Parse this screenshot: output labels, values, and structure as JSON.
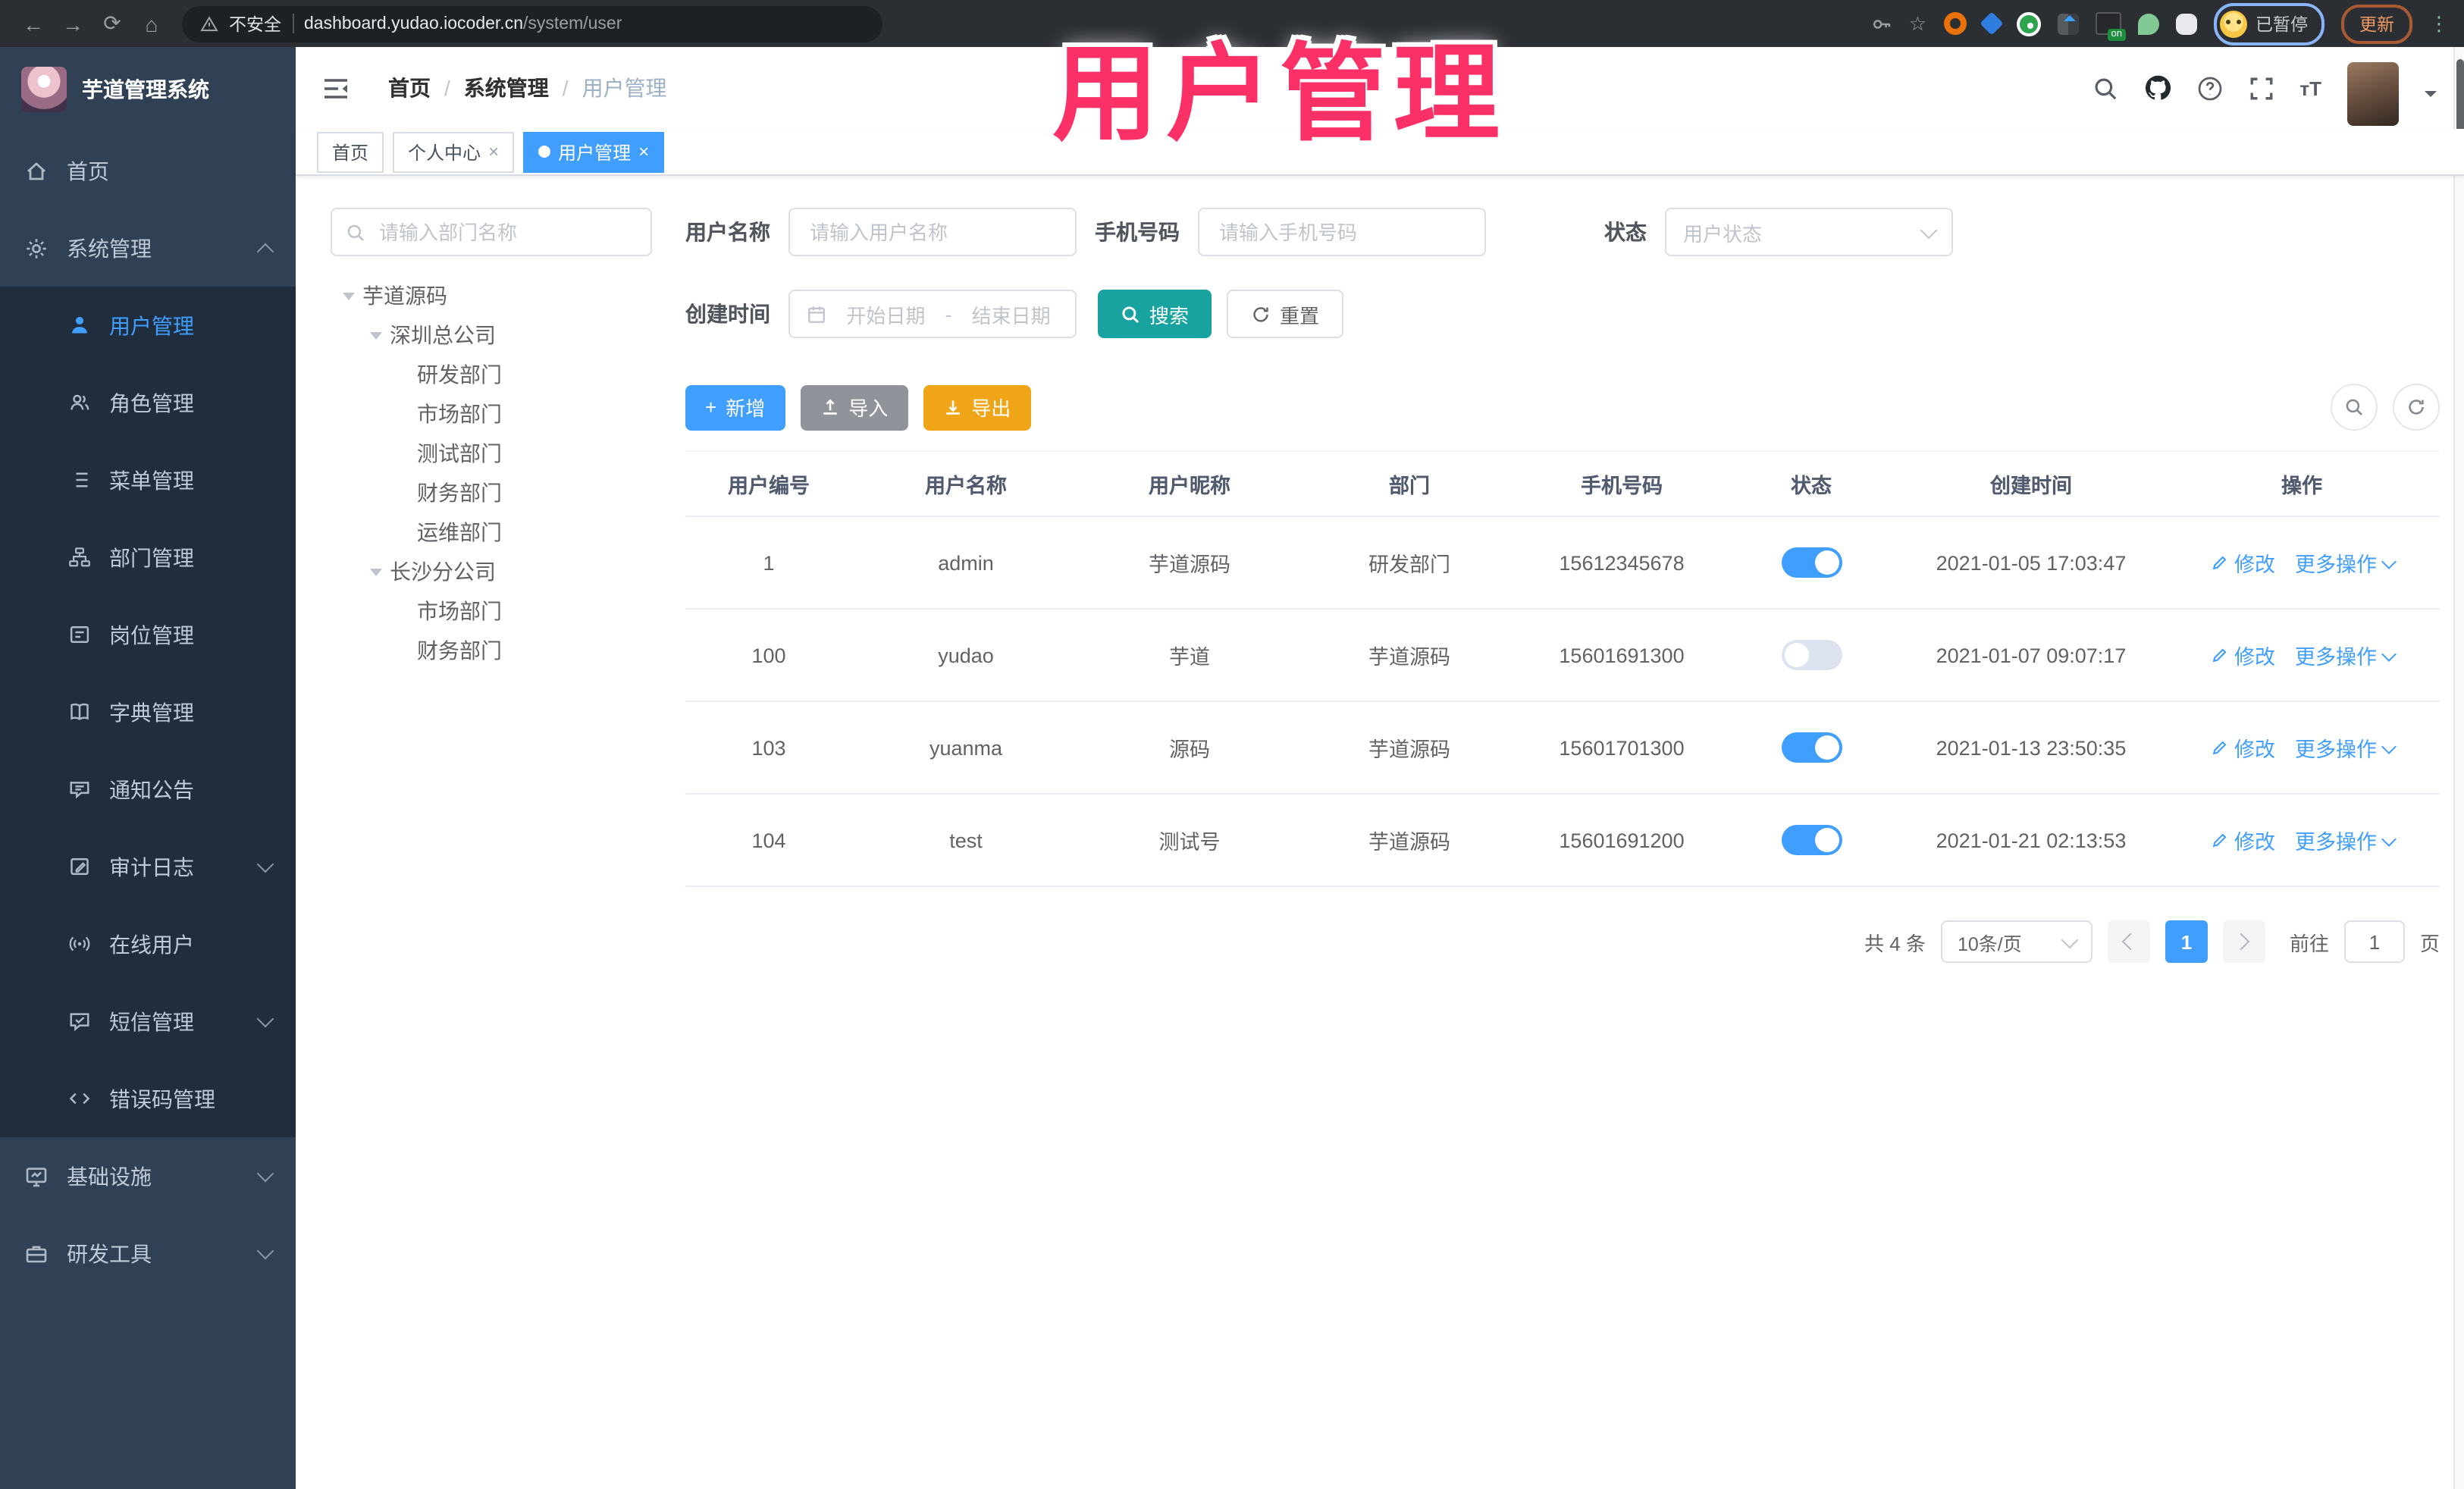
{
  "browser": {
    "security_label": "不安全",
    "url_domain": "dashboard.yudao.iocoder.cn",
    "url_path": "/system/user",
    "profile_status": "已暂停",
    "update_label": "更新"
  },
  "watermark": "用户管理",
  "sidebar": {
    "logo_title": "芋道管理系统",
    "items": [
      {
        "label": "首页"
      },
      {
        "label": "系统管理"
      },
      {
        "label": "用户管理"
      },
      {
        "label": "角色管理"
      },
      {
        "label": "菜单管理"
      },
      {
        "label": "部门管理"
      },
      {
        "label": "岗位管理"
      },
      {
        "label": "字典管理"
      },
      {
        "label": "通知公告"
      },
      {
        "label": "审计日志"
      },
      {
        "label": "在线用户"
      },
      {
        "label": "短信管理"
      },
      {
        "label": "错误码管理"
      },
      {
        "label": "基础设施"
      },
      {
        "label": "研发工具"
      }
    ]
  },
  "navbar": {
    "breadcrumb": [
      "首页",
      "系统管理",
      "用户管理"
    ]
  },
  "tabs": [
    {
      "label": "首页",
      "closable": false,
      "active": false
    },
    {
      "label": "个人中心",
      "closable": true,
      "active": false
    },
    {
      "label": "用户管理",
      "closable": true,
      "active": true
    }
  ],
  "tree": {
    "placeholder": "请输入部门名称",
    "nodes": [
      {
        "label": "芋道源码",
        "level": 1,
        "expanded": true
      },
      {
        "label": "深圳总公司",
        "level": 2,
        "expanded": true
      },
      {
        "label": "研发部门",
        "level": 3
      },
      {
        "label": "市场部门",
        "level": 3
      },
      {
        "label": "测试部门",
        "level": 3
      },
      {
        "label": "财务部门",
        "level": 3
      },
      {
        "label": "运维部门",
        "level": 3
      },
      {
        "label": "长沙分公司",
        "level": 2,
        "expanded": true
      },
      {
        "label": "市场部门",
        "level": 3
      },
      {
        "label": "财务部门",
        "level": 3
      }
    ]
  },
  "filters": {
    "username_label": "用户名称",
    "username_placeholder": "请输入用户名称",
    "mobile_label": "手机号码",
    "mobile_placeholder": "请输入手机号码",
    "status_label": "状态",
    "status_placeholder": "用户状态",
    "created_label": "创建时间",
    "date_start_placeholder": "开始日期",
    "date_separator": "-",
    "date_end_placeholder": "结束日期",
    "search_label": "搜索",
    "reset_label": "重置"
  },
  "toolbar": {
    "add_label": "新增",
    "import_label": "导入",
    "export_label": "导出"
  },
  "table": {
    "columns": [
      "用户编号",
      "用户名称",
      "用户昵称",
      "部门",
      "手机号码",
      "状态",
      "创建时间",
      "操作"
    ],
    "action_edit": "修改",
    "action_more": "更多操作",
    "rows": [
      {
        "id": "1",
        "username": "admin",
        "nickname": "芋道源码",
        "dept": "研发部门",
        "mobile": "15612345678",
        "status": true,
        "created": "2021-01-05 17:03:47"
      },
      {
        "id": "100",
        "username": "yudao",
        "nickname": "芋道",
        "dept": "芋道源码",
        "mobile": "15601691300",
        "status": false,
        "created": "2021-01-07 09:07:17"
      },
      {
        "id": "103",
        "username": "yuanma",
        "nickname": "源码",
        "dept": "芋道源码",
        "mobile": "15601701300",
        "status": true,
        "created": "2021-01-13 23:50:35"
      },
      {
        "id": "104",
        "username": "test",
        "nickname": "测试号",
        "dept": "芋道源码",
        "mobile": "15601691200",
        "status": true,
        "created": "2021-01-21 02:13:53"
      }
    ]
  },
  "pagination": {
    "total_text": "共 4 条",
    "page_size": "10条/页",
    "current_page": "1",
    "goto_label": "前往",
    "goto_value": "1",
    "unit_label": "页"
  },
  "colors": {
    "primary": "#409eff",
    "search_button": "#18a3a0",
    "export_button": "#f0a519",
    "import_button": "#909399",
    "sidebar_bg": "#304156",
    "submenu_bg": "#1f2d3d",
    "watermark": "#fb3066",
    "toggle_on": "#409eff"
  }
}
